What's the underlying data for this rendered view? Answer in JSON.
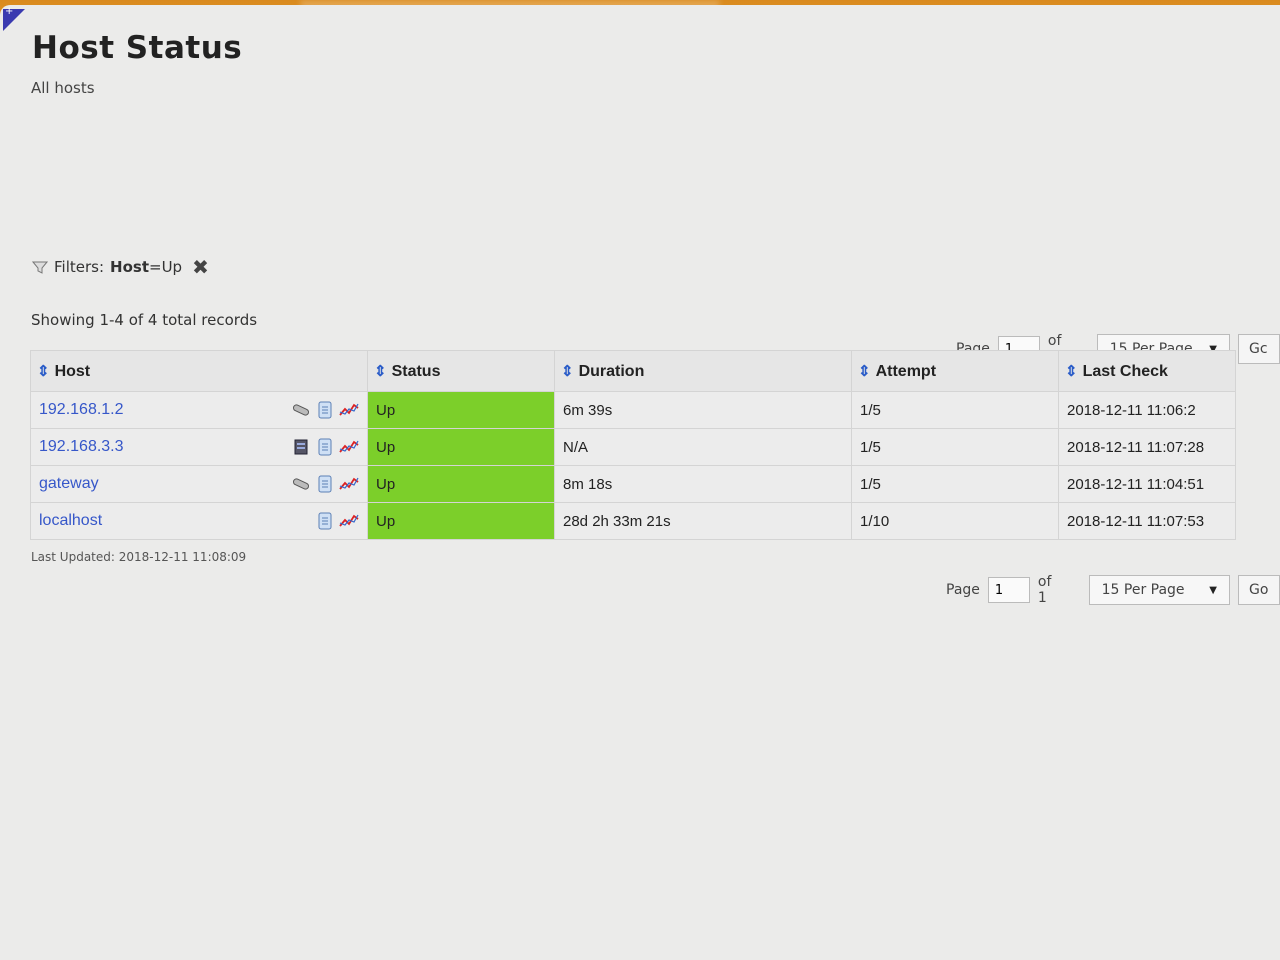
{
  "page": {
    "title": "Host Status",
    "subtitle": "All hosts",
    "filters_label": "Filters:",
    "filter_key": "Host",
    "filter_value": "=Up",
    "records_text": "Showing 1-4 of 4 total records",
    "last_updated": "Last Updated: 2018-12-11 11:08:09"
  },
  "pager": {
    "page_label": "Page",
    "page_value": "1",
    "of_label": "of 1",
    "per_page": "15 Per Page",
    "go_label": "Go",
    "go_label_cut": "Gc"
  },
  "columns": {
    "host": "Host",
    "status": "Status",
    "duration": "Duration",
    "attempt": "Attempt",
    "last_check": "Last Check"
  },
  "rows": [
    {
      "host": "192.168.1.2",
      "status": "Up",
      "duration": "6m 39s",
      "attempt": "1/5",
      "last_check": "2018-12-11 11:06:2"
    },
    {
      "host": "192.168.3.3",
      "status": "Up",
      "duration": "N/A",
      "attempt": "1/5",
      "last_check": "2018-12-11 11:07:28"
    },
    {
      "host": "gateway",
      "status": "Up",
      "duration": "8m 18s",
      "attempt": "1/5",
      "last_check": "2018-12-11 11:04:51"
    },
    {
      "host": "localhost",
      "status": "Up",
      "duration": "28d 2h 33m 21s",
      "attempt": "1/10",
      "last_check": "2018-12-11 11:07:53"
    }
  ],
  "row_icons": [
    [
      "network-cable-icon",
      "notes-icon",
      "graph-icon"
    ],
    [
      "server-icon",
      "notes-icon",
      "graph-icon"
    ],
    [
      "network-cable-icon",
      "notes-icon",
      "graph-icon"
    ],
    [
      "notes-icon",
      "graph-icon"
    ]
  ],
  "colors": {
    "status_up": "#7ccf2a",
    "link": "#3657c9",
    "header_bar": "#e59a2e"
  }
}
